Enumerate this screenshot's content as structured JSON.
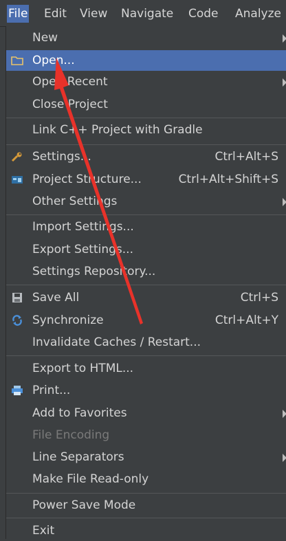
{
  "menubar": {
    "file": "File",
    "edit": "Edit",
    "view": "View",
    "navigate": "Navigate",
    "code": "Code",
    "analyze": "Analyze"
  },
  "file_menu": {
    "new": "New",
    "open": "Open...",
    "open_recent": "Open Recent",
    "close_project": "Close Project",
    "link_cpp": "Link C++ Project with Gradle",
    "settings": "Settings...",
    "settings_shortcut": "Ctrl+Alt+S",
    "project_structure": "Project Structure...",
    "project_structure_shortcut": "Ctrl+Alt+Shift+S",
    "other_settings": "Other Settings",
    "import_settings": "Import Settings...",
    "export_settings": "Export Settings...",
    "settings_repository": "Settings Repository...",
    "save_all": "Save All",
    "save_all_shortcut": "Ctrl+S",
    "synchronize": "Synchronize",
    "synchronize_shortcut": "Ctrl+Alt+Y",
    "invalidate_caches": "Invalidate Caches / Restart...",
    "export_html": "Export to HTML...",
    "print": "Print...",
    "add_favorites": "Add to Favorites",
    "file_encoding": "File Encoding",
    "line_separators": "Line Separators",
    "make_read_only": "Make File Read-only",
    "power_save": "Power Save Mode",
    "exit": "Exit"
  },
  "colors": {
    "menu_bg": "#3c3f41",
    "selection": "#4b6eaf",
    "annotation_arrow": "#e8322a"
  }
}
